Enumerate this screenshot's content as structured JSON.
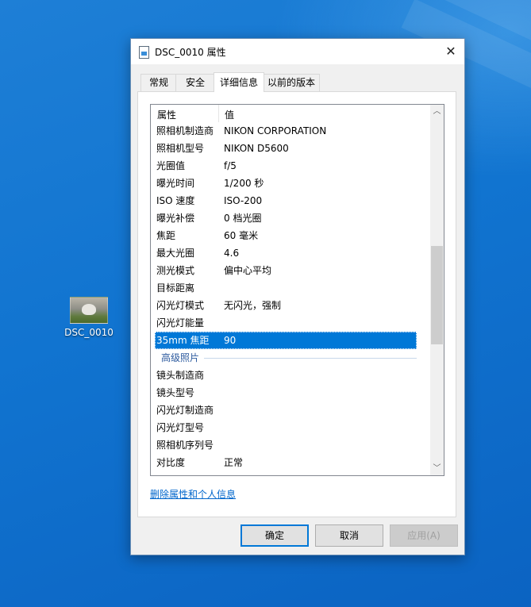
{
  "desktop": {
    "icon_label": "DSC_0010"
  },
  "window": {
    "title": "DSC_0010 属性",
    "close_glyph": "✕"
  },
  "tabs": [
    {
      "label": "常规"
    },
    {
      "label": "安全"
    },
    {
      "label": "详细信息"
    },
    {
      "label": "以前的版本"
    }
  ],
  "list": {
    "header": {
      "property": "属性",
      "value": "值"
    },
    "rows": [
      {
        "key": "照相机制造商",
        "value": "NIKON CORPORATION"
      },
      {
        "key": "照相机型号",
        "value": "NIKON D5600"
      },
      {
        "key": "光圈值",
        "value": "f/5"
      },
      {
        "key": "曝光时间",
        "value": "1/200 秒"
      },
      {
        "key": "ISO 速度",
        "value": "ISO-200"
      },
      {
        "key": "曝光补偿",
        "value": "0 档光圈"
      },
      {
        "key": "焦距",
        "value": "60 毫米"
      },
      {
        "key": "最大光圈",
        "value": "4.6"
      },
      {
        "key": "测光模式",
        "value": "偏中心平均"
      },
      {
        "key": "目标距离",
        "value": ""
      },
      {
        "key": "闪光灯模式",
        "value": "无闪光，强制"
      },
      {
        "key": "闪光灯能量",
        "value": ""
      },
      {
        "key": "35mm 焦距",
        "value": "90"
      },
      {
        "key": "高级照片",
        "value": ""
      },
      {
        "key": "镜头制造商",
        "value": ""
      },
      {
        "key": "镜头型号",
        "value": ""
      },
      {
        "key": "闪光灯制造商",
        "value": ""
      },
      {
        "key": "闪光灯型号",
        "value": ""
      },
      {
        "key": "照相机序列号",
        "value": ""
      },
      {
        "key": "对比度",
        "value": "正常"
      }
    ]
  },
  "link": {
    "label": "删除属性和个人信息"
  },
  "buttons": {
    "ok": "确定",
    "cancel": "取消",
    "apply": "应用(A)"
  }
}
